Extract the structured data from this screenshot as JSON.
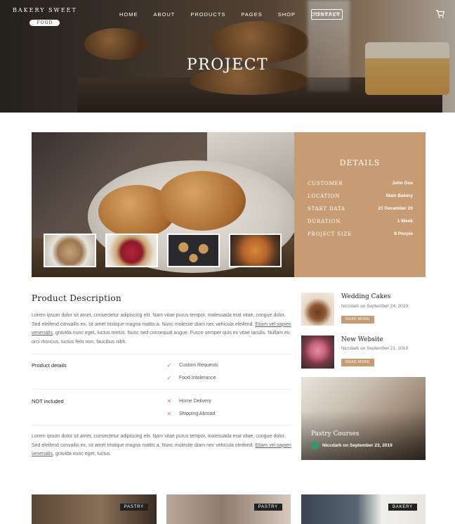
{
  "header": {
    "logo_main": "BAKERY SWEET",
    "logo_sub": "FOOD",
    "nav": [
      "HOME",
      "ABOUT",
      "PRODUCTS",
      "PAGES",
      "SHOP",
      "CONTACT"
    ],
    "reserve_label": "RESERVE",
    "cart_icon": "cart-icon"
  },
  "hero": {
    "title": "PROJECT"
  },
  "details": {
    "title": "DETAILS",
    "rows": [
      {
        "label": "CUSTOMER",
        "value": "John Doe"
      },
      {
        "label": "LOCATION",
        "value": "Main Bakery"
      },
      {
        "label": "START DATA",
        "value": "21 December 20"
      },
      {
        "label": "DURATION",
        "value": "1 Week"
      },
      {
        "label": "PROJECT SIZE",
        "value": "8 People"
      }
    ]
  },
  "description": {
    "title": "Product Description",
    "para1": "Lorem ipsum dolor sit amet, consectetur adipiscing elit. Nam vitae purus tempor, malesuada erat vitae, congue dolor. Sed eleifend convallis ex, sit amet tristique magna mattis a. Nunc molestie diam nec vehicula eleifend.",
    "para1_link": "Etiam vel sapien venenatis",
    "para1_tail": ", gravida nunc eget, luctus metus. Nunc sed consequat augue. Fusce semper quis ex vitae iaculis. Nullam eu orci rhoncus, luctus felis non, faucibus nibh.",
    "para2": "Lorem ipsum dolor sit amet, consectetur adipiscing elit. Nam vitae purus tempor, malesuada erat vitae, congue dolor. Sed eleifend convallis ex, sit amet tristique magna mattis a. Nunc molestie diam nec vehicula eleifend.",
    "para2_link": "Etiam vel sapien venenatis",
    "para2_tail": ", gravida nunc eget, luctus"
  },
  "features": {
    "included_label": "Product details",
    "included": [
      "Custom Requests",
      "Food Intolerance"
    ],
    "excluded_label": "NOT included",
    "excluded": [
      "Home Delivery",
      "Shipping Abroad"
    ]
  },
  "sidebar": {
    "posts": [
      {
        "title": "Wedding Cakes",
        "meta": "Niccdark on September 24, 2019",
        "button": "READ MORE"
      },
      {
        "title": "New Website",
        "meta": "Niccdark on September 21, 2019",
        "button": "READ MORE"
      }
    ],
    "feature": {
      "title": "Pastry Courses",
      "meta": "Niccdark on September 23, 2019"
    }
  },
  "bottom_cards": [
    {
      "badge": "PASTRY"
    },
    {
      "badge": "PASTRY"
    },
    {
      "badge": "BAKERY"
    }
  ]
}
